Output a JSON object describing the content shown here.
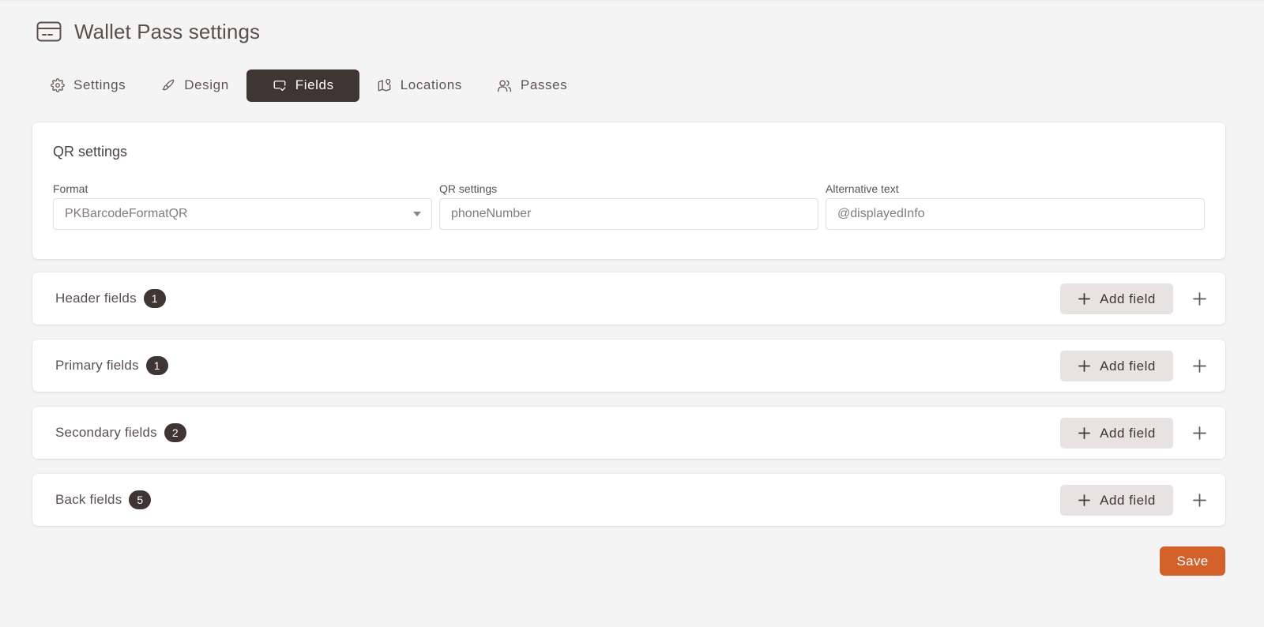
{
  "page": {
    "title": "Wallet Pass settings",
    "title_icon": "credit-card-icon"
  },
  "tabs": [
    {
      "label": "Settings",
      "icon": "gear-icon",
      "active": false
    },
    {
      "label": "Design",
      "icon": "paintbrush-icon",
      "active": false
    },
    {
      "label": "Fields",
      "icon": "fields-icon",
      "active": true
    },
    {
      "label": "Locations",
      "icon": "map-pin-icon",
      "active": false
    },
    {
      "label": "Passes",
      "icon": "users-icon",
      "active": false
    }
  ],
  "qr_settings": {
    "title": "QR settings",
    "format": {
      "label": "Format",
      "value": "PKBarcodeFormatQR"
    },
    "qr_value": {
      "label": "QR settings",
      "value": "phoneNumber"
    },
    "alt_text": {
      "label": "Alternative text",
      "value": "@displayedInfo"
    }
  },
  "sections": [
    {
      "label": "Header fields",
      "count": "1",
      "add_label": "Add field"
    },
    {
      "label": "Primary fields",
      "count": "1",
      "add_label": "Add field"
    },
    {
      "label": "Secondary fields",
      "count": "2",
      "add_label": "Add field"
    },
    {
      "label": "Back fields",
      "count": "5",
      "add_label": "Add field"
    }
  ],
  "actions": {
    "save_label": "Save"
  },
  "colors": {
    "background": "#f5f4f4",
    "accent_dark": "#3f3532",
    "save": "#d4612a",
    "add_button_bg": "#e6e3e2"
  }
}
